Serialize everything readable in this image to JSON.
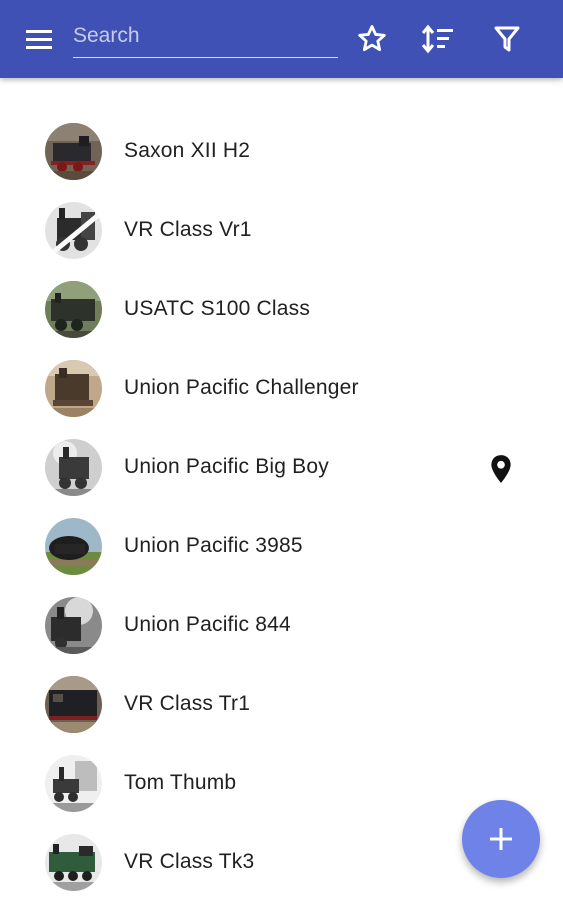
{
  "appbar": {
    "color": "#3f51b5",
    "menu_icon": "hamburger-menu-icon",
    "search": {
      "placeholder": "Search",
      "value": ""
    },
    "actions": [
      "star-outline-icon",
      "sort-icon",
      "filter-icon"
    ]
  },
  "list": {
    "items": [
      {
        "label": "Saxon XII H2",
        "thumb": "dark"
      },
      {
        "label": "VR Class Vr1",
        "thumb": "bw"
      },
      {
        "label": "USATC S100 Class",
        "thumb": "green"
      },
      {
        "label": "Union Pacific Challenger",
        "thumb": "sepia"
      },
      {
        "label": "Union Pacific Big Boy",
        "thumb": "bw",
        "map_pin": "map-pin-icon"
      },
      {
        "label": "Union Pacific 3985",
        "thumb": "sky"
      },
      {
        "label": "Union Pacific 844",
        "thumb": "bw"
      },
      {
        "label": "VR Class Tr1",
        "thumb": "dark"
      },
      {
        "label": "Tom Thumb",
        "thumb": "bw"
      },
      {
        "label": "VR Class Tk3",
        "thumb": "green"
      }
    ]
  },
  "fab": {
    "icon": "plus-icon",
    "color": "#6f82e8"
  }
}
